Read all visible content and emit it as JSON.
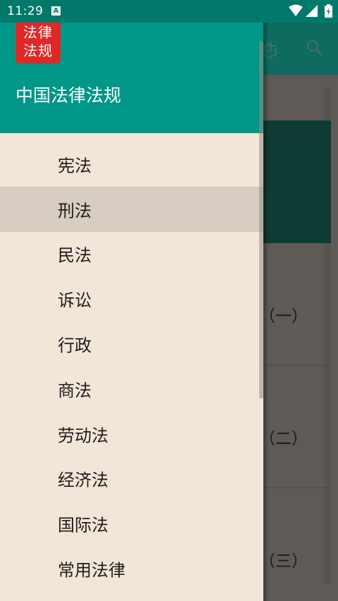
{
  "status_bar": {
    "time": "11:29",
    "notification_letter": "A"
  },
  "background_app": {
    "entries": [
      {
        "label": "（一）"
      },
      {
        "label": "（二）"
      },
      {
        "label": "（三）"
      }
    ]
  },
  "drawer": {
    "logo_line1": "法律",
    "logo_line2": "法规",
    "title": "中国法律法规",
    "items": [
      {
        "label": "宪法",
        "selected": false
      },
      {
        "label": "刑法",
        "selected": true
      },
      {
        "label": "民法",
        "selected": false
      },
      {
        "label": "诉讼",
        "selected": false
      },
      {
        "label": "行政",
        "selected": false
      },
      {
        "label": "商法",
        "selected": false
      },
      {
        "label": "劳动法",
        "selected": false
      },
      {
        "label": "经济法",
        "selected": false
      },
      {
        "label": "国际法",
        "selected": false
      },
      {
        "label": "常用法律",
        "selected": false
      }
    ]
  },
  "colors": {
    "header": "#009688",
    "status_bar": "#00796b",
    "drawer_bg": "#f2e6d9",
    "selected_bg": "#d7cdc2",
    "logo_bg": "#e02828"
  },
  "icons": [
    "wifi-icon",
    "signal-icon",
    "battery-icon",
    "settings-icon",
    "search-icon"
  ]
}
